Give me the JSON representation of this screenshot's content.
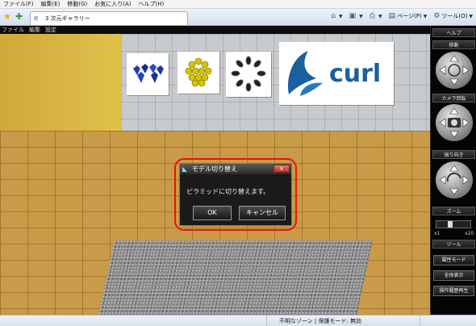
{
  "browser": {
    "menu": [
      "ファイル(F)",
      "編集(E)",
      "移動(G)",
      "お気に入り(A)",
      "ヘルプ(H)"
    ],
    "tab_title": "3 次元ギャラリー",
    "commands": {
      "page": "ページ(P)",
      "tools": "ツール(O)"
    }
  },
  "app": {
    "menu": [
      "ファイル",
      "編集",
      "設定"
    ],
    "artwork_logo_text": "curl",
    "sidebar": {
      "help": "ヘルプ",
      "move": "移動",
      "camera_rotate": "カメラ回転",
      "pan": "振り向き",
      "zoom": "ズーム",
      "zoom_min": "x1",
      "zoom_max": "x20",
      "tools": "ツール",
      "attribute_mode": "属性モード",
      "show_all": "全体表示",
      "history_replay": "操作履歴再生"
    }
  },
  "dialog": {
    "title": "モデル切り替え",
    "close_label": "x",
    "message": "ピラミッドに切り替えます。",
    "ok": "OK",
    "cancel": "キャンセル"
  },
  "status": {
    "zone": "不明なゾーン | 保護モード: 無効"
  },
  "colors": {
    "accent_ring": "#e11111",
    "curl_blue": "#1a5f9e"
  }
}
